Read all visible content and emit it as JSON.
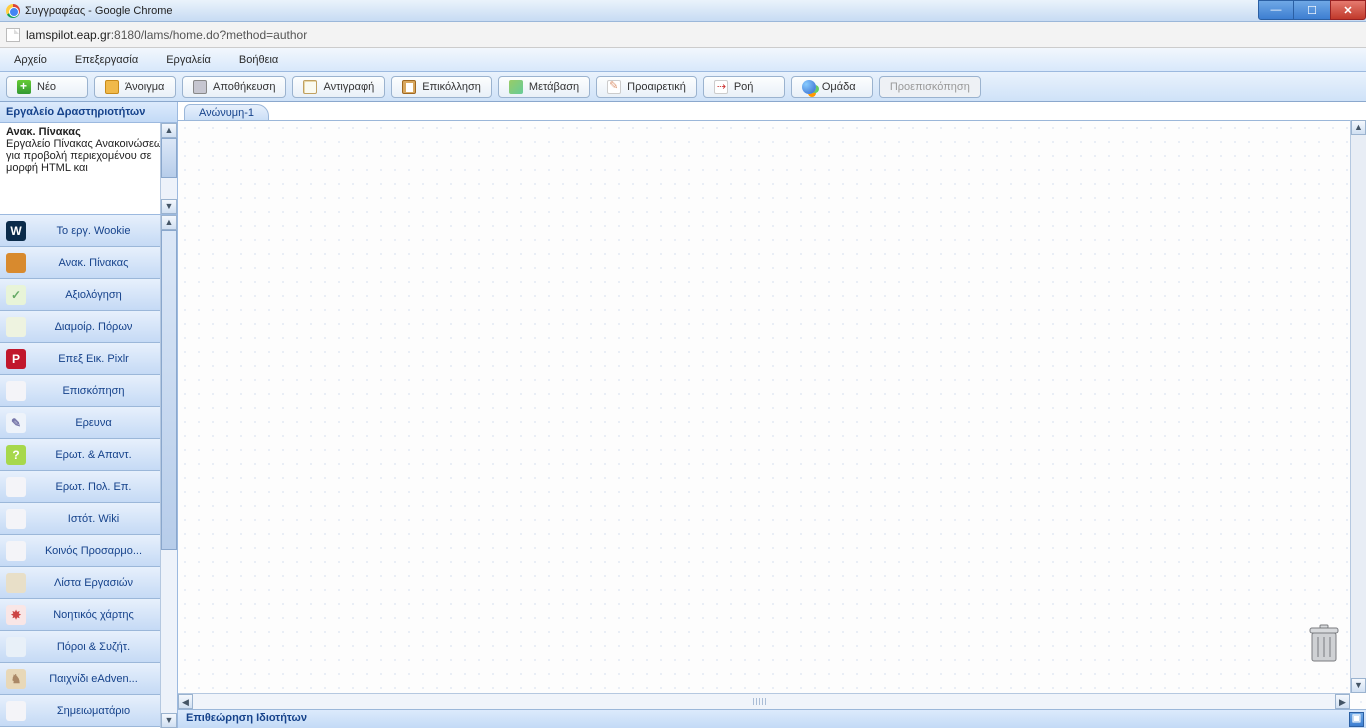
{
  "chrome": {
    "title": "Συγγραφέας - Google Chrome"
  },
  "address": {
    "host": "lamspilot.eap.gr",
    "path": ":8180/lams/home.do?method=author"
  },
  "menu": {
    "file": "Αρχείο",
    "edit": "Επεξεργασία",
    "tools": "Εργαλεία",
    "help": "Βοήθεια"
  },
  "toolbar": {
    "new": "Νέο",
    "open": "Άνοιγμα",
    "save": "Αποθήκευση",
    "copy": "Αντιγραφή",
    "paste": "Επικόλληση",
    "transition": "Μετάβαση",
    "optional": "Προαιρετική",
    "flow": "Ροή",
    "group": "Ομάδα",
    "preview": "Προεπισκόπηση"
  },
  "sidebar": {
    "header": "Εργαλείο Δραστηριοτήτων",
    "desc_title": "Ανακ. Πίνακας",
    "desc_body": "Εργαλείο Πίνακας Ανακοινώσεων για προβολή περιεχομένου σε μορφή HTML και",
    "items": [
      {
        "label": "Το εργ. Wookie",
        "iconColor": "#0b2b4a",
        "fg": "#fff",
        "glyph": "W"
      },
      {
        "label": "Ανακ. Πίνακας",
        "iconColor": "#d88a2e",
        "fg": "#fff",
        "glyph": ""
      },
      {
        "label": "Αξιολόγηση",
        "iconColor": "#e8f4d8",
        "fg": "#6a6",
        "glyph": "✓"
      },
      {
        "label": "Διαμοίρ. Πόρων",
        "iconColor": "#eef3e0",
        "fg": "#8a8",
        "glyph": ""
      },
      {
        "label": "Επεξ Εικ. Pixlr",
        "iconColor": "#c1172c",
        "fg": "#fff",
        "glyph": "P"
      },
      {
        "label": "Επισκόπηση",
        "iconColor": "#f4f4f8",
        "fg": "#aaa",
        "glyph": ""
      },
      {
        "label": "Ερευνα",
        "iconColor": "#eef3fa",
        "fg": "#77a",
        "glyph": "✎"
      },
      {
        "label": "Ερωτ. & Απαντ.",
        "iconColor": "#a7d84c",
        "fg": "#fff",
        "glyph": "?"
      },
      {
        "label": "Ερωτ. Πολ. Επ.",
        "iconColor": "#f4f4f8",
        "fg": "#aaa",
        "glyph": ""
      },
      {
        "label": "Ιστότ. Wiki",
        "iconColor": "#f4f4f8",
        "fg": "#aaa",
        "glyph": ""
      },
      {
        "label": "Κοινός Προσαρμο...",
        "iconColor": "#f4f4f8",
        "fg": "#aaa",
        "glyph": ""
      },
      {
        "label": "Λίστα Εργασιών",
        "iconColor": "#e8dfc8",
        "fg": "#a88",
        "glyph": ""
      },
      {
        "label": "Νοητικός χάρτης",
        "iconColor": "#f9e6e6",
        "fg": "#c44",
        "glyph": "✸"
      },
      {
        "label": "Πόροι & Συζήτ.",
        "iconColor": "#e8f0f8",
        "fg": "#69a",
        "glyph": ""
      },
      {
        "label": "Παιχνίδι eAdven...",
        "iconColor": "#e8d8b8",
        "fg": "#a86",
        "glyph": "♞"
      },
      {
        "label": "Σημειωματάριο",
        "iconColor": "#f4f4f8",
        "fg": "#aaa",
        "glyph": ""
      }
    ]
  },
  "canvas": {
    "tab": "Ανώνυμη-1"
  },
  "inspector": {
    "title": "Επιθεώρηση Ιδιοτήτων"
  }
}
